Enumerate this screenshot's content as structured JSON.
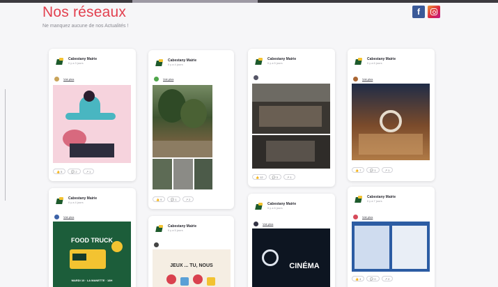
{
  "header": {
    "title": "Nos réseaux",
    "subtitle": "Ne manquez aucune de nos Actualités !"
  },
  "social": {
    "facebook_icon": "facebook-icon",
    "instagram_icon": "instagram-icon",
    "facebook_label": "f",
    "colors": {
      "title": "#e2404f",
      "facebook": "#3b5998",
      "instagram": "#dc2743"
    }
  },
  "posts": [
    {
      "author": "Cabestany Mairie",
      "date": "Il y a 3 jours",
      "see_more": "Voir plus",
      "media_text": "",
      "reactions": [
        "👍 5",
        "💬 2",
        "↗ 1"
      ]
    },
    {
      "author": "Cabestany Mairie",
      "date": "Il y a 4 jours",
      "see_more": "Voir plus",
      "media_text": "FOOD TRUCK",
      "media_sub": "MARDI 10 · LA MANETTE · 18H",
      "reactions": []
    },
    {
      "author": "Cabestany Mairie",
      "date": "Il y a 4 jours",
      "see_more": "Voir plus",
      "media_text": "",
      "reactions": [
        "👍 9",
        "💬 1",
        "↗ 2"
      ]
    },
    {
      "author": "Cabestany Mairie",
      "date": "Il y a 5 jours",
      "see_more": "",
      "media_text": "JEUX ... TU, NOUS",
      "reactions": []
    },
    {
      "author": "Cabestany Mairie",
      "date": "Il y a 5 jours",
      "see_more": "",
      "media_text": "",
      "reactions": [
        "👍 12",
        "💬 3",
        "↗ 1"
      ]
    },
    {
      "author": "Cabestany Mairie",
      "date": "Il y a 6 jours",
      "see_more": "Voir plus",
      "media_text": "CINÉMA",
      "reactions": []
    },
    {
      "author": "Cabestany Mairie",
      "date": "Il y a 6 jours",
      "see_more": "Voir plus",
      "media_text": "",
      "reactions": [
        "👍 7",
        "💬 1",
        "↗ 1"
      ]
    },
    {
      "author": "Cabestany Mairie",
      "date": "Il y a 7 jours",
      "see_more": "Voir plus",
      "media_text": "",
      "reactions": [
        "👍 4",
        "💬 0",
        "↗ 2"
      ]
    }
  ]
}
